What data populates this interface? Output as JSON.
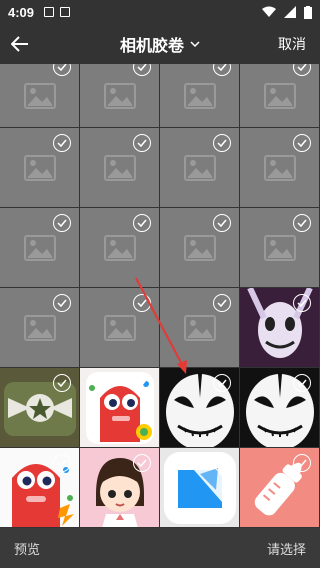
{
  "status": {
    "time": "4:09"
  },
  "header": {
    "title": "相机胶卷",
    "cancel_label": "取消"
  },
  "grid": {
    "rows": [
      [
        "placeholder",
        "placeholder",
        "placeholder",
        "placeholder"
      ],
      [
        "placeholder",
        "placeholder",
        "placeholder",
        "placeholder"
      ],
      [
        "placeholder",
        "placeholder",
        "placeholder",
        "placeholder"
      ],
      [
        "placeholder",
        "placeholder",
        "placeholder",
        "creepy-mask"
      ],
      [
        "army-star",
        "red-creature-app",
        "white-mask",
        "white-mask"
      ],
      [
        "red-creature",
        "cartoon-girl",
        "blue-app-icon",
        "baby-bottle"
      ]
    ]
  },
  "bottom": {
    "preview_label": "预览",
    "select_label": "请选择"
  },
  "colors": {
    "accent": "#e53935",
    "placeholder": "#7d7d7d"
  }
}
